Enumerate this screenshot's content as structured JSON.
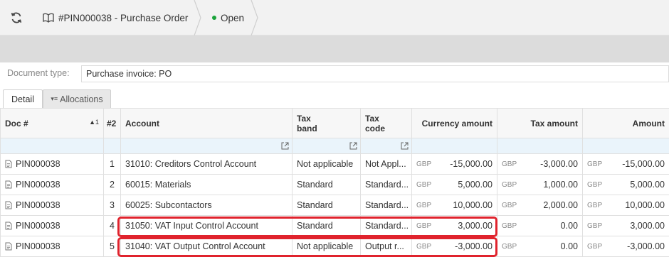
{
  "header": {
    "doc_title": "#PIN000038 - Purchase Order",
    "status": "Open",
    "status_color": "#1aa33a"
  },
  "document_type": {
    "label": "Document type:",
    "value": "Purchase invoice: PO"
  },
  "tabs": [
    {
      "label": "Detail",
      "active": true
    },
    {
      "label": "Allocations",
      "active": false
    }
  ],
  "grid": {
    "columns": {
      "doc": "Doc #",
      "doc_sort": "▲1",
      "seq": "#2",
      "account": "Account",
      "tax_band_1": "Tax",
      "tax_band_2": "band",
      "tax_code_1": "Tax",
      "tax_code_2": "code",
      "currency_amount": "Currency amount",
      "tax_amount": "Tax amount",
      "amount": "Amount"
    },
    "rows": [
      {
        "doc": "PIN000038",
        "seq": "1",
        "account": "31010: Creditors Control Account",
        "tax_band": "Not applicable",
        "tax_code": "Not Appl...",
        "ccy1": "GBP",
        "currency_amount": "-15,000.00",
        "ccy2": "GBP",
        "tax_amount": "-3,000.00",
        "ccy3": "GBP",
        "amount": "-15,000.00"
      },
      {
        "doc": "PIN000038",
        "seq": "2",
        "account": "60015: Materials",
        "tax_band": "Standard",
        "tax_code": "Standard...",
        "ccy1": "GBP",
        "currency_amount": "5,000.00",
        "ccy2": "GBP",
        "tax_amount": "1,000.00",
        "ccy3": "GBP",
        "amount": "5,000.00"
      },
      {
        "doc": "PIN000038",
        "seq": "3",
        "account": "60025: Subcontactors",
        "tax_band": "Standard",
        "tax_code": "Standard...",
        "ccy1": "GBP",
        "currency_amount": "10,000.00",
        "ccy2": "GBP",
        "tax_amount": "2,000.00",
        "ccy3": "GBP",
        "amount": "10,000.00"
      },
      {
        "doc": "PIN000038",
        "seq": "4",
        "account": "31050: VAT Input Control Account",
        "tax_band": "Standard",
        "tax_code": "Standard...",
        "ccy1": "GBP",
        "currency_amount": "3,000.00",
        "ccy2": "GBP",
        "tax_amount": "0.00",
        "ccy3": "GBP",
        "amount": "3,000.00"
      },
      {
        "doc": "PIN000038",
        "seq": "5",
        "account": "31040: VAT Output Control Account",
        "tax_band": "Not applicable",
        "tax_code": "Output r...",
        "ccy1": "GBP",
        "currency_amount": "-3,000.00",
        "ccy2": "GBP",
        "tax_amount": "0.00",
        "ccy3": "GBP",
        "amount": "-3,000.00"
      }
    ]
  },
  "highlight_color": "#e0232d"
}
